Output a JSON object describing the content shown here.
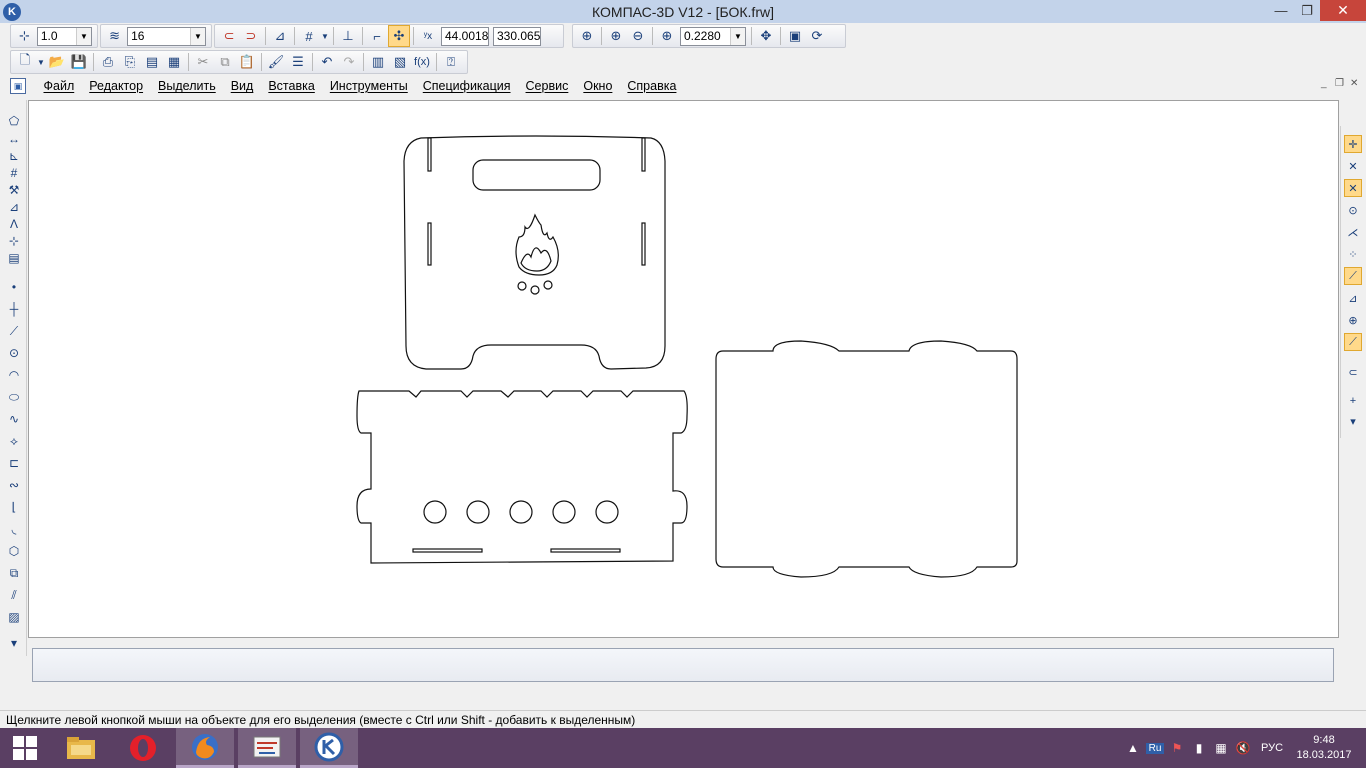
{
  "window": {
    "title": "КОМПАС-3D V12 - [БОК.frw]",
    "app_icon": "kompas-icon",
    "min": "—",
    "max": "❐",
    "close": "✕"
  },
  "toolbar1": {
    "line_width": "1.0",
    "layer": "16",
    "coord_x": "44.0018",
    "coord_y": "330.065",
    "zoom": "0.2280"
  },
  "menu": {
    "items": [
      "Файл",
      "Редактор",
      "Выделить",
      "Вид",
      "Вставка",
      "Инструменты",
      "Спецификация",
      "Сервис",
      "Окно",
      "Справка"
    ]
  },
  "status": {
    "hint": "Щелкните левой кнопкой мыши на объекте для его выделения (вместе с Ctrl или Shift - добавить к выделенным)"
  },
  "taskbar": {
    "lang_badge": "Ru",
    "lang": "РУС",
    "time": "9:48",
    "date": "18.03.2017",
    "apps": [
      "file-explorer-icon",
      "opera-icon",
      "firefox-icon",
      "drawing-app-icon",
      "kompas-icon"
    ]
  },
  "colors": {
    "title_bar": "#c3d3ea",
    "close_button": "#c7453b",
    "taskbar": "#5a3f63",
    "active_tool": "#ffd98a"
  }
}
